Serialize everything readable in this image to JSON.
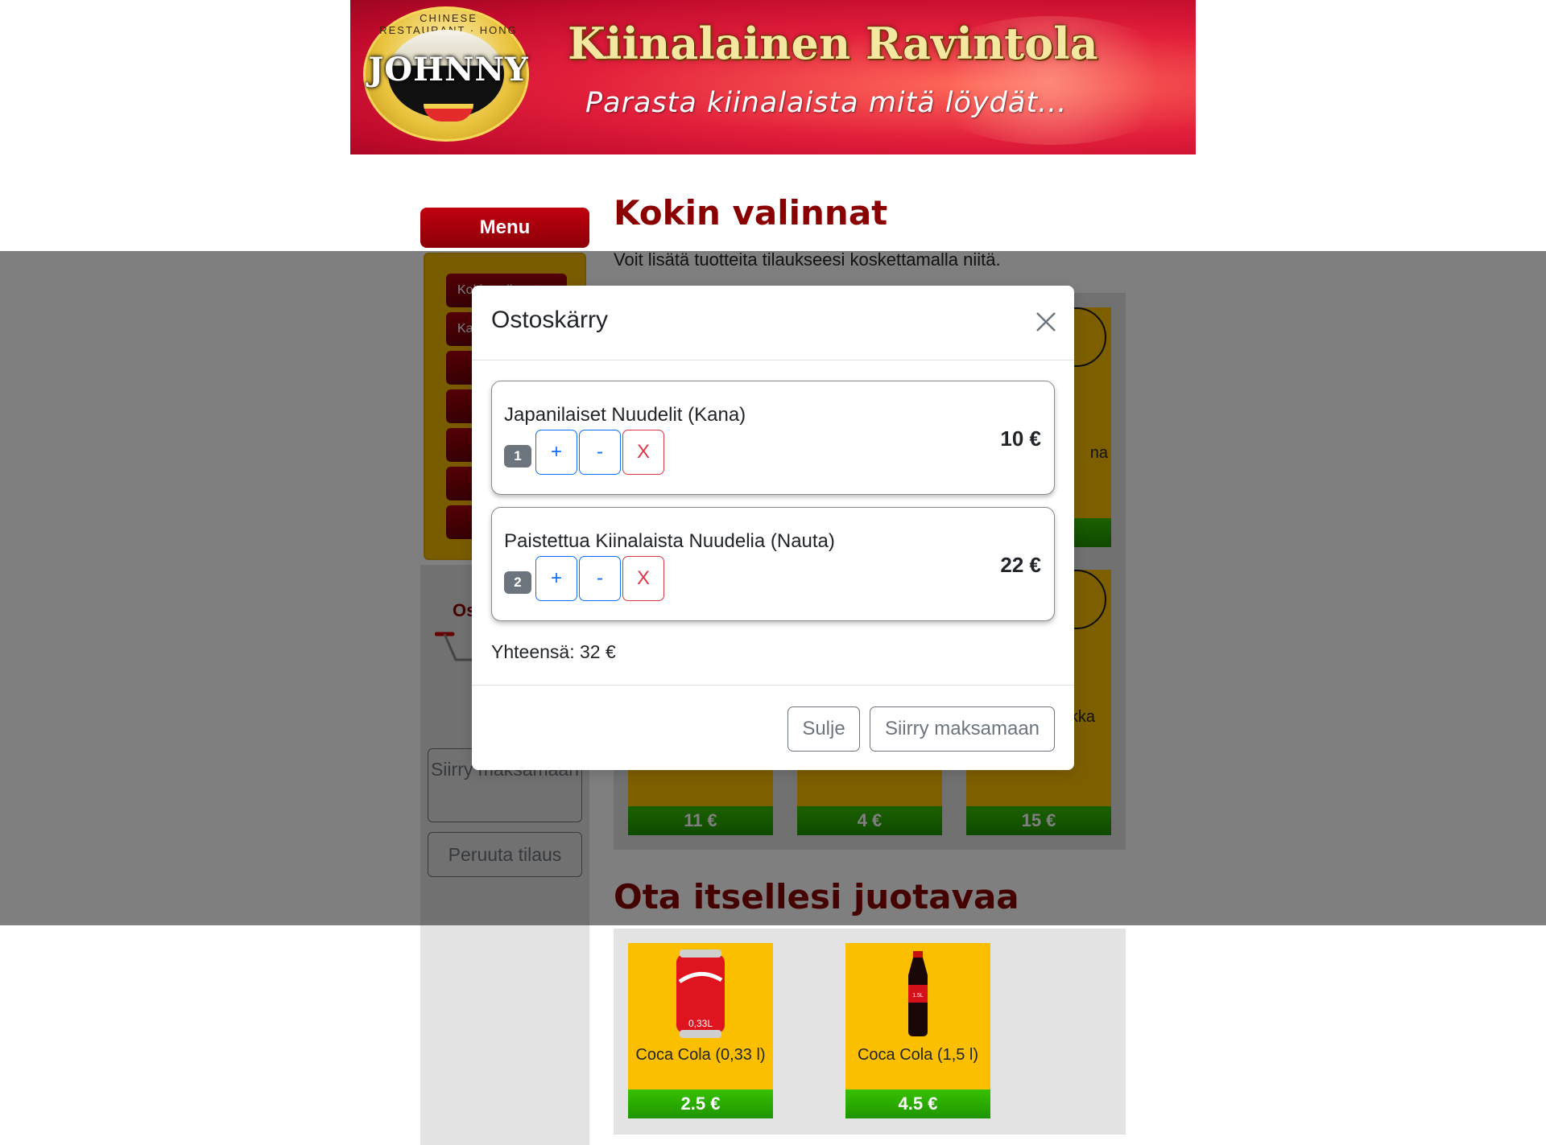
{
  "header": {
    "logo_word": "JOHNNY",
    "logo_ring_text": "CHINESE RESTAURANT · HONG KONG",
    "title": "Kiinalainen Ravintola",
    "slogan": "Parasta kiinalaista mitä löydät..."
  },
  "sidebar": {
    "menu_label": "Menu",
    "categories": [
      "Kokin valinnat",
      "Kana",
      "",
      "",
      "",
      "",
      ""
    ],
    "cart_title": "Ostoskärry",
    "checkout_label": "Siirry maksamaan",
    "cancel_label": "Peruuta tilaus"
  },
  "main": {
    "title": "Kokin valinnat",
    "description": "Voit lisätä tuotteita tilaukseesi koskettamalla niitä.",
    "visible_name_fragments": [
      "na",
      "kka"
    ],
    "visible_prices": [
      "11 €",
      "4 €",
      "15 €"
    ],
    "drinks_title": "Ota itsellesi juotavaa",
    "drinks": [
      {
        "name": "Coca Cola (0,33 l)",
        "price": "2.5 €",
        "label": "0,33L"
      },
      {
        "name": "Coca Cola (1,5 l)",
        "price": "4.5 €",
        "label": "1.5L"
      }
    ]
  },
  "modal": {
    "title": "Ostoskärry",
    "items": [
      {
        "name": "Japanilaiset Nuudelit (Kana)",
        "qty": "1",
        "price": "10 €",
        "plus": "+",
        "minus": "-",
        "remove": "X"
      },
      {
        "name": "Paistettua Kiinalaista Nuudelia (Nauta)",
        "qty": "2",
        "price": "22 €",
        "plus": "+",
        "minus": "-",
        "remove": "X"
      }
    ],
    "total": "Yhteensä: 32 €",
    "close_label": "Sulje",
    "checkout_label": "Siirry maksamaan"
  },
  "colors": {
    "brand_red": "#8a0000",
    "menu_yellow": "#fbbf00",
    "price_green": "#1e9400",
    "overlay": "rgba(0,0,0,0.5)"
  }
}
